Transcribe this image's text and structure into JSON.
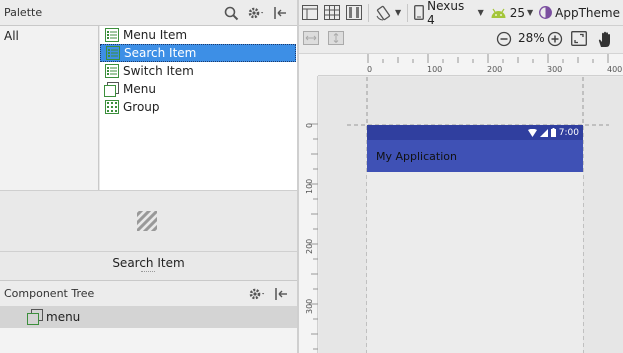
{
  "palette": {
    "title": "Palette",
    "categories": [
      "All"
    ],
    "items": [
      {
        "label": "Menu Item",
        "icon": "menu-item-icon"
      },
      {
        "label": "Search Item",
        "icon": "search-item-icon"
      },
      {
        "label": "Switch Item",
        "icon": "switch-item-icon"
      },
      {
        "label": "Menu",
        "icon": "menu-icon"
      },
      {
        "label": "Group",
        "icon": "group-icon"
      }
    ],
    "selected_index": 1,
    "preview_label": "Search Item"
  },
  "component_tree": {
    "title": "Component Tree",
    "nodes": [
      {
        "label": "menu",
        "icon": "menu-icon"
      }
    ]
  },
  "toolbar": {
    "device": "Nexus 4",
    "api": "25",
    "theme": "AppTheme",
    "zoom": "28%"
  },
  "rulers": {
    "top": [
      "0",
      "100",
      "200",
      "300",
      "400"
    ],
    "left": [
      "0",
      "100",
      "200",
      "300"
    ]
  },
  "device_preview": {
    "status_time": "7:00",
    "app_title": "My Application",
    "colors": {
      "status_bar": "#303f9f",
      "app_bar": "#3f51b5"
    }
  },
  "colors": {
    "selection": "#3d8fe6",
    "android_green": "#a4c639",
    "accent_purple": "#7b4fa0"
  }
}
